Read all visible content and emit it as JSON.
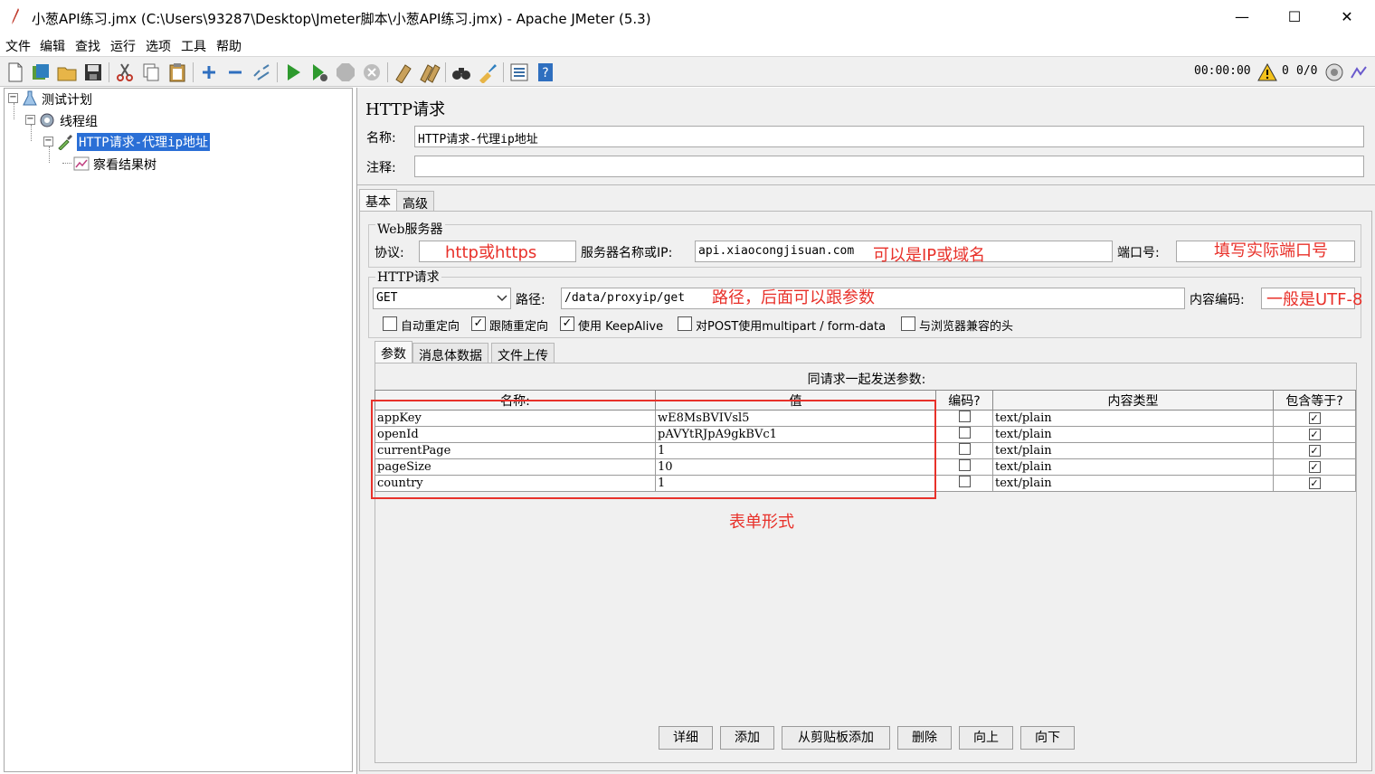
{
  "window": {
    "title": "小葱API练习.jmx (C:\\Users\\93287\\Desktop\\Jmeter脚本\\小葱API练习.jmx) - Apache JMeter (5.3)",
    "minimize": "—",
    "maximize": "☐",
    "close": "✕"
  },
  "menu": [
    "文件",
    "编辑",
    "查找",
    "运行",
    "选项",
    "工具",
    "帮助"
  ],
  "status": {
    "timer": "00:00:00",
    "warn_count": "0",
    "threads": "0/0"
  },
  "tree": {
    "plan": "测试计划",
    "thread_group": "线程组",
    "sampler": "HTTP请求-代理ip地址",
    "listener": "察看结果树"
  },
  "panel": {
    "title": "HTTP请求",
    "name_label": "名称:",
    "name_value": "HTTP请求-代理ip地址",
    "comment_label": "注释:",
    "comment_value": "",
    "tabs": [
      "基本",
      "高级"
    ],
    "web_server": {
      "group_label": "Web服务器",
      "protocol_label": "协议:",
      "protocol_value": "",
      "server_label": "服务器名称或IP:",
      "server_value": "api.xiaocongjisuan.com",
      "port_label": "端口号:",
      "port_value": ""
    },
    "http_request": {
      "group_label": "HTTP请求",
      "method": "GET",
      "path_label": "路径:",
      "path_value": "/data/proxyip/get",
      "encoding_label": "内容编码:",
      "encoding_value": "",
      "checkboxes": [
        {
          "label": "自动重定向",
          "checked": false
        },
        {
          "label": "跟随重定向",
          "checked": true
        },
        {
          "label": "使用 KeepAlive",
          "checked": true
        },
        {
          "label": "对POST使用multipart / form-data",
          "checked": false
        },
        {
          "label": "与浏览器兼容的头",
          "checked": false
        }
      ]
    },
    "subtabs": [
      "参数",
      "消息体数据",
      "文件上传"
    ],
    "params_caption": "同请求一起发送参数:",
    "columns": [
      "名称:",
      "值",
      "编码?",
      "内容类型",
      "包含等于?"
    ],
    "rows": [
      {
        "name": "appKey",
        "value": "wE8MsBVIVsl5",
        "encode": false,
        "ctype": "text/plain",
        "include_eq": true
      },
      {
        "name": "openId",
        "value": "pAVYtRJpA9gkBVc1",
        "encode": false,
        "ctype": "text/plain",
        "include_eq": true
      },
      {
        "name": "currentPage",
        "value": "1",
        "encode": false,
        "ctype": "text/plain",
        "include_eq": true
      },
      {
        "name": "pageSize",
        "value": "10",
        "encode": false,
        "ctype": "text/plain",
        "include_eq": true
      },
      {
        "name": "country",
        "value": "1",
        "encode": false,
        "ctype": "text/plain",
        "include_eq": true
      }
    ],
    "buttons": [
      "详细",
      "添加",
      "从剪贴板添加",
      "删除",
      "向上",
      "向下"
    ]
  },
  "annotations": {
    "protocol": "http或https",
    "server": "可以是IP或域名",
    "port": "填写实际端口号",
    "path": "路径，后面可以跟参数",
    "encoding": "一般是UTF-8",
    "form": "表单形式"
  },
  "colors": {
    "annotation": "#e8312a",
    "selection": "#2a6fd6"
  }
}
